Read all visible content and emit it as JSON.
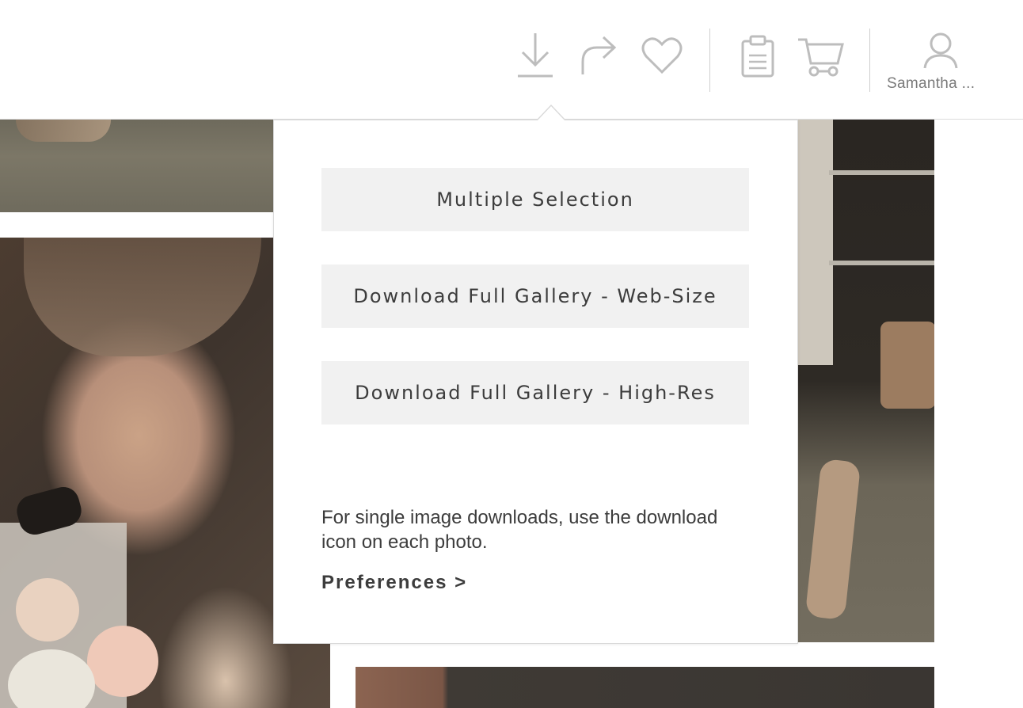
{
  "header": {
    "icons": [
      {
        "name": "download-icon"
      },
      {
        "name": "share-icon"
      },
      {
        "name": "favorite-heart-icon"
      },
      {
        "name": "clipboard-icon"
      },
      {
        "name": "cart-icon"
      }
    ],
    "account": {
      "icon": "user-icon",
      "name": "Samantha ..."
    },
    "icon_color": "#bdbdbd"
  },
  "download_menu": {
    "options": [
      {
        "label": "Multiple Selection"
      },
      {
        "label": "Download Full Gallery - Web-Size"
      },
      {
        "label": "Download Full Gallery - High-Res"
      }
    ],
    "help_text": "For single image downloads, use the download icon on each photo.",
    "preferences_link": "Preferences >"
  },
  "colors": {
    "button_bg": "#f1f1f1",
    "text": "#3c3c3c",
    "panel_border": "#d9d9d9"
  }
}
